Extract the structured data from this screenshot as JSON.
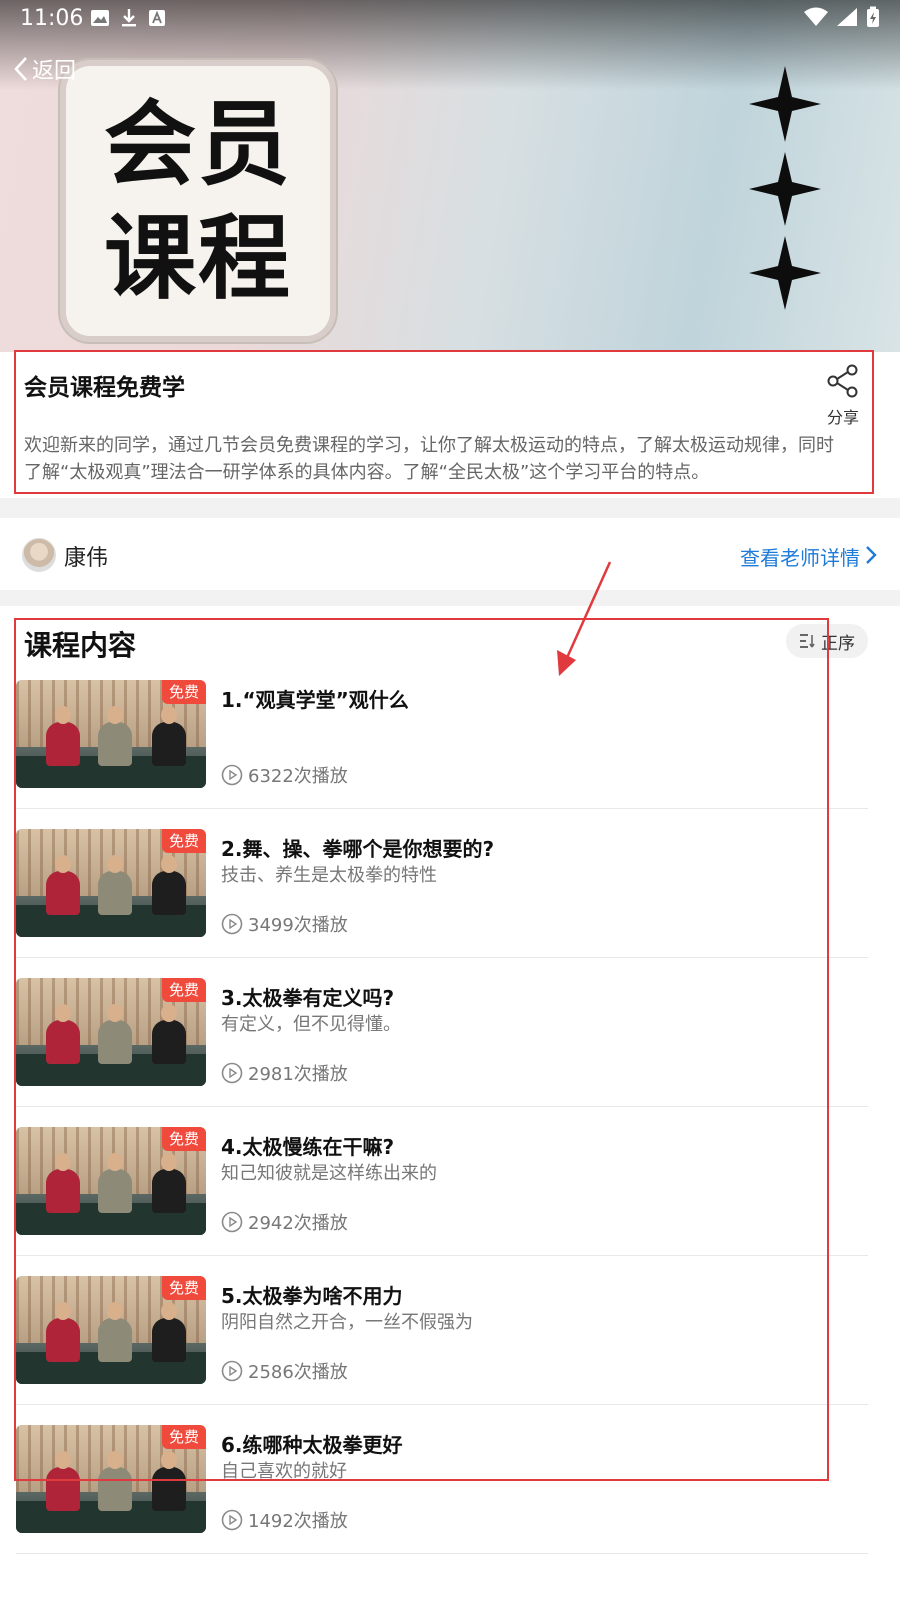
{
  "status_bar": {
    "time": "11:06",
    "left_icons": [
      "image-icon",
      "download-icon",
      "text-a-icon"
    ],
    "right_icons": [
      "wifi-icon",
      "signal-icon",
      "battery-charging-icon"
    ]
  },
  "nav": {
    "back_label": "返回",
    "back_icon": "chevron-left-icon"
  },
  "hero": {
    "line1": "会员",
    "line2": "课程",
    "decoration": "sparkle-icon"
  },
  "info": {
    "title": "会员课程免费学",
    "share_label": "分享",
    "share_icon": "share-icon",
    "description": "欢迎新来的同学，通过几节会员免费课程的学习，让你了解太极运动的特点，了解太极运动规律，同时了解“太极观真”理法合一研学体系的具体内容。了解“全民太极”这个学习平台的特点。"
  },
  "teacher": {
    "name": "康伟",
    "detail_link": "查看老师详情"
  },
  "course": {
    "title": "课程内容",
    "sort_label": "正序",
    "sort_icon": "sort-icon",
    "free_tag": "免费",
    "items": [
      {
        "title": "1.“观真学堂”观什么",
        "subtitle": "",
        "plays": "6322次播放",
        "caption": ""
      },
      {
        "title": "2.舞、操、拳哪个是你想要的?",
        "subtitle": "技击、养生是太极拳的特性",
        "plays": "3499次播放",
        "caption": ""
      },
      {
        "title": "3.太极拳有定义吗?",
        "subtitle": "有定义，但不见得懂。",
        "plays": "2981次播放",
        "caption": ""
      },
      {
        "title": "4.太极慢练在干嘛?",
        "subtitle": "知己知彼就是这样练出来的",
        "plays": "2942次播放",
        "caption": ""
      },
      {
        "title": "5.太极拳为啥不用力",
        "subtitle": "阴阳自然之开合，一丝不假强为",
        "plays": "2586次播放",
        "caption": ""
      },
      {
        "title": "6.练哪种太极拳更好",
        "subtitle": "自己喜欢的就好",
        "plays": "1492次播放",
        "caption": ""
      }
    ]
  },
  "colors": {
    "accent_link": "#1e7bd9",
    "free_tag": "#f04a3c",
    "annotation": "#e0393e"
  }
}
